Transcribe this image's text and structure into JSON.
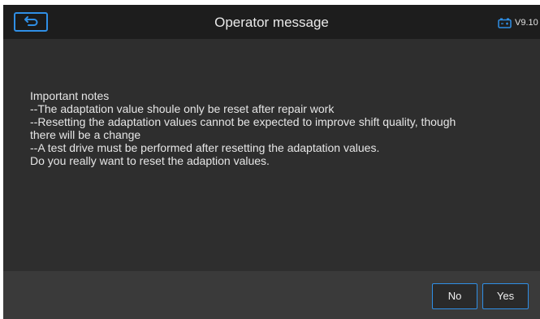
{
  "header": {
    "title": "Operator message",
    "version": "V9.10",
    "accent_color": "#2f8fe6"
  },
  "icons": {
    "back": "return-arrow-icon",
    "battery": "battery-icon"
  },
  "message": {
    "lines": [
      "Important notes",
      "--The adaptation value shoule only be reset after repair work",
      "--Resetting the adaptation values cannot be expected to improve shift quality, though",
      "there will be a change",
      "--A test drive must be performed after resetting the adaptation values.",
      "Do you really want to reset the adaption values."
    ]
  },
  "footer": {
    "no_label": "No",
    "yes_label": "Yes"
  }
}
